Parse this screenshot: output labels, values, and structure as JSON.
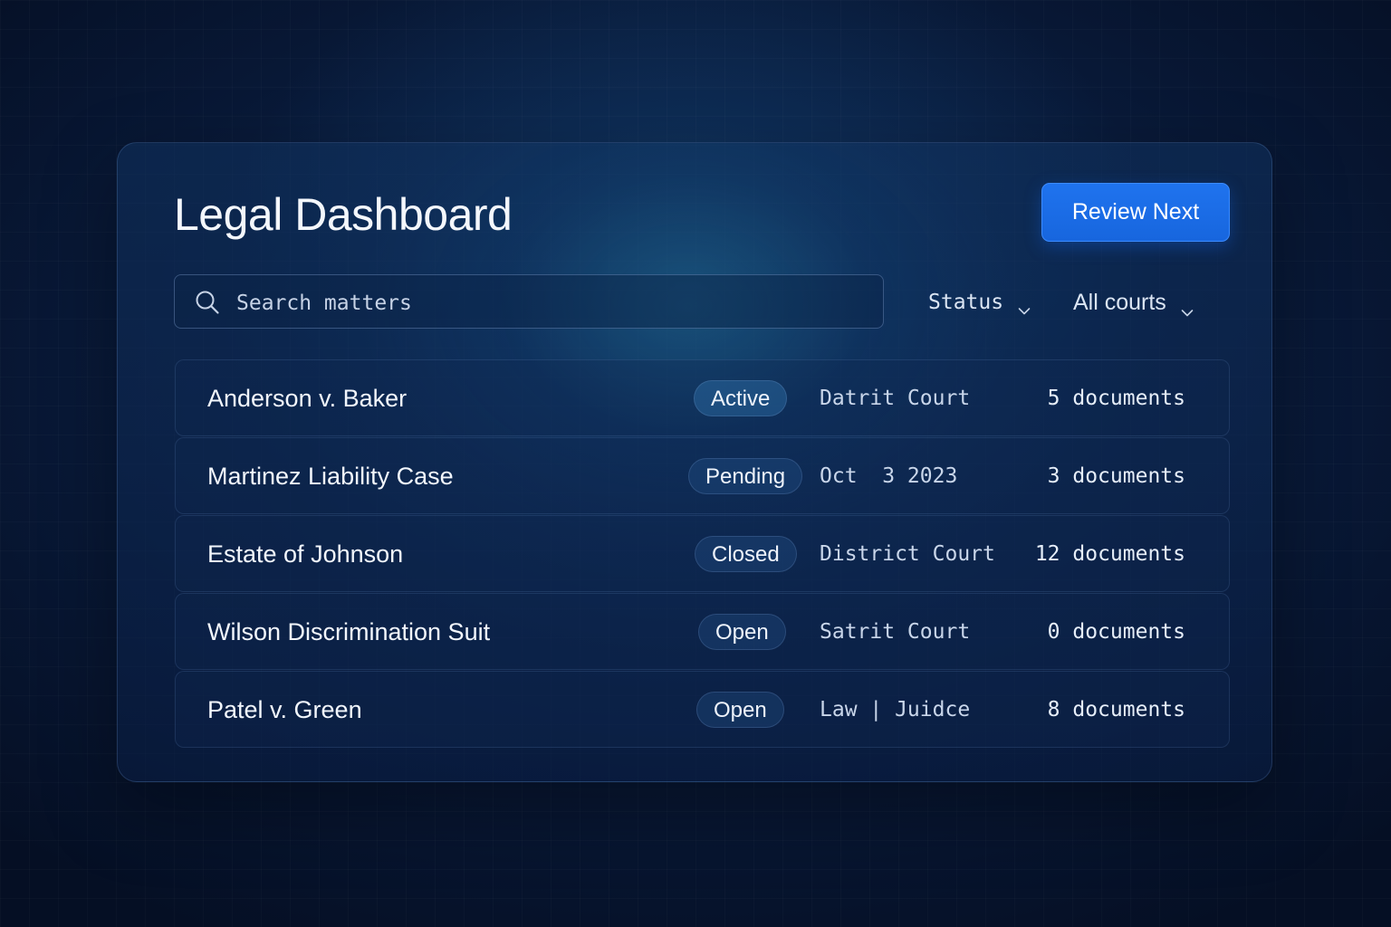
{
  "header": {
    "title": "Legal Dashboard",
    "primary_action_label": "Review Next"
  },
  "search": {
    "placeholder": "Search matters",
    "icon": "search-icon"
  },
  "filters": {
    "status_label": "Status",
    "courts_label": "All courts",
    "icon": "chevron-down-icon"
  },
  "matters": [
    {
      "name": "Anderson v. Baker",
      "status": "Active",
      "court": "Datrit Court",
      "documents": "5 documents"
    },
    {
      "name": "Martinez Liability Case",
      "status": "Pending",
      "court": "Oct  3 2023",
      "documents": "3 documents"
    },
    {
      "name": "Estate of Johnson",
      "status": "Closed",
      "court": "District Court",
      "documents": "12 documents"
    },
    {
      "name": "Wilson Discrimination Suit",
      "status": "Open",
      "court": "Satrit Court",
      "documents": "0 documents"
    },
    {
      "name": "Patel v. Green",
      "status": "Open",
      "court": "Law | Juidce",
      "documents": "8 documents"
    }
  ],
  "colors": {
    "accent": "#1f73ee",
    "background": "#0a1d3f",
    "text": "#f4f7fc"
  }
}
